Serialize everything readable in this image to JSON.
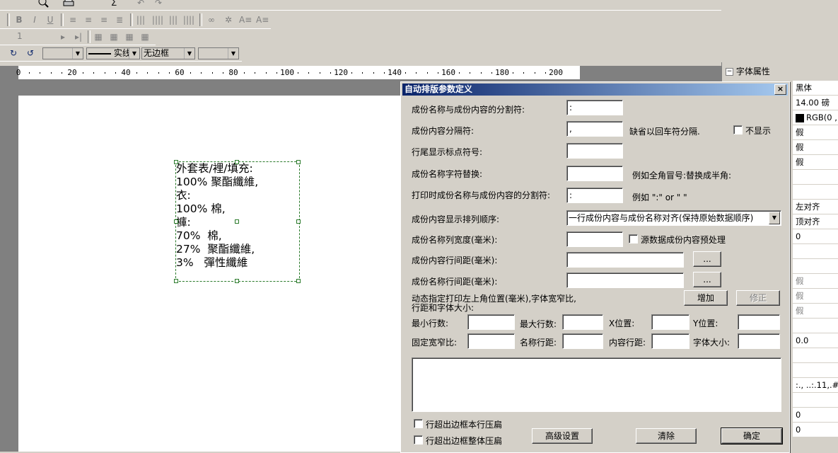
{
  "toolbar1": {
    "icons": [
      "preview-icon",
      "print-icon",
      "sigma-icon",
      "undo-icon",
      "redo-icon"
    ]
  },
  "toolbar2": {
    "bold": "B",
    "italic": "I",
    "underline": "U"
  },
  "toolbar3": {
    "page_number": "1"
  },
  "toolbar4": {
    "line_style": "实线",
    "border_style": "无边框"
  },
  "ruler": {
    "labels": [
      "0",
      "20",
      "40",
      "60",
      "80",
      "100",
      "120",
      "140",
      "160",
      "180",
      "200"
    ]
  },
  "textbox": {
    "lines": [
      "外套表/裡/填充:",
      "100% 聚酯纖維,",
      "衣:",
      "100% 棉,",
      "褲:",
      "70%  棉,",
      "27%  聚酯纖維,",
      "3%   彈性纖維"
    ]
  },
  "properties": {
    "header": "字体属性",
    "values": [
      "黑体",
      "14.00 磅",
      "RGB(0 ,",
      "假",
      "假",
      "假",
      "",
      "",
      "左对齐",
      "顶对齐",
      "0",
      "",
      "",
      "假",
      "假",
      "假",
      "",
      "0.0",
      "",
      "",
      ":.,  ..:.11,.#",
      "",
      "0",
      "0"
    ]
  },
  "dialog": {
    "title": "自动排版参数定义",
    "close": "×",
    "rows": {
      "name_content_sep_label": "成份名称与成份内容的分割符:",
      "name_content_sep_value": ":",
      "content_sep_label": "成份内容分隔符:",
      "content_sep_value": ",",
      "content_sep_hint": "缺省以回车符分隔.",
      "hide_label": "不显示",
      "line_end_label": "行尾显示标点符号:",
      "line_end_value": "",
      "replace_label": "成份名称字符替换:",
      "replace_value": "",
      "replace_hint": "例如全角冒号:替换成半角:",
      "print_sep_label": "打印时成份名称与成份内容的分割符:",
      "print_sep_value": ":",
      "print_sep_hint": "例如 \":\" or \" \"",
      "order_label": "成份内容显示排列顺序:",
      "order_value": "一行成份内容与成份名称对齐(保持原始数据顺序)",
      "col_width_label": "成份名称列宽度(毫米):",
      "col_width_value": "",
      "preprocess_label": "源数据成份内容预处理",
      "content_spacing_label": "成份内容行间距(毫米):",
      "content_spacing_value": "",
      "name_spacing_label": "成份名称行间距(毫米):",
      "name_spacing_value": "",
      "ellipsis": "...",
      "dynamic_label_1": "动态指定打印左上角位置(毫米),字体宽窄比,",
      "dynamic_label_2": "行距和字体大小:",
      "add_button": "增加",
      "modify_button": "修正",
      "min_rows_label": "最小行数:",
      "max_rows_label": "最大行数:",
      "x_pos_label": "X位置:",
      "y_pos_label": "Y位置:",
      "ratio_label": "固定宽窄比:",
      "name_line_label": "名称行距:",
      "content_line_label": "内容行距:",
      "font_size_label": "字体大小:",
      "overflow_row_label": "行超出边框本行压扁",
      "overflow_all_label": "行超出边框整体压扁",
      "advanced_button": "高级设置",
      "clear_button": "清除",
      "ok_button": "确定"
    }
  }
}
